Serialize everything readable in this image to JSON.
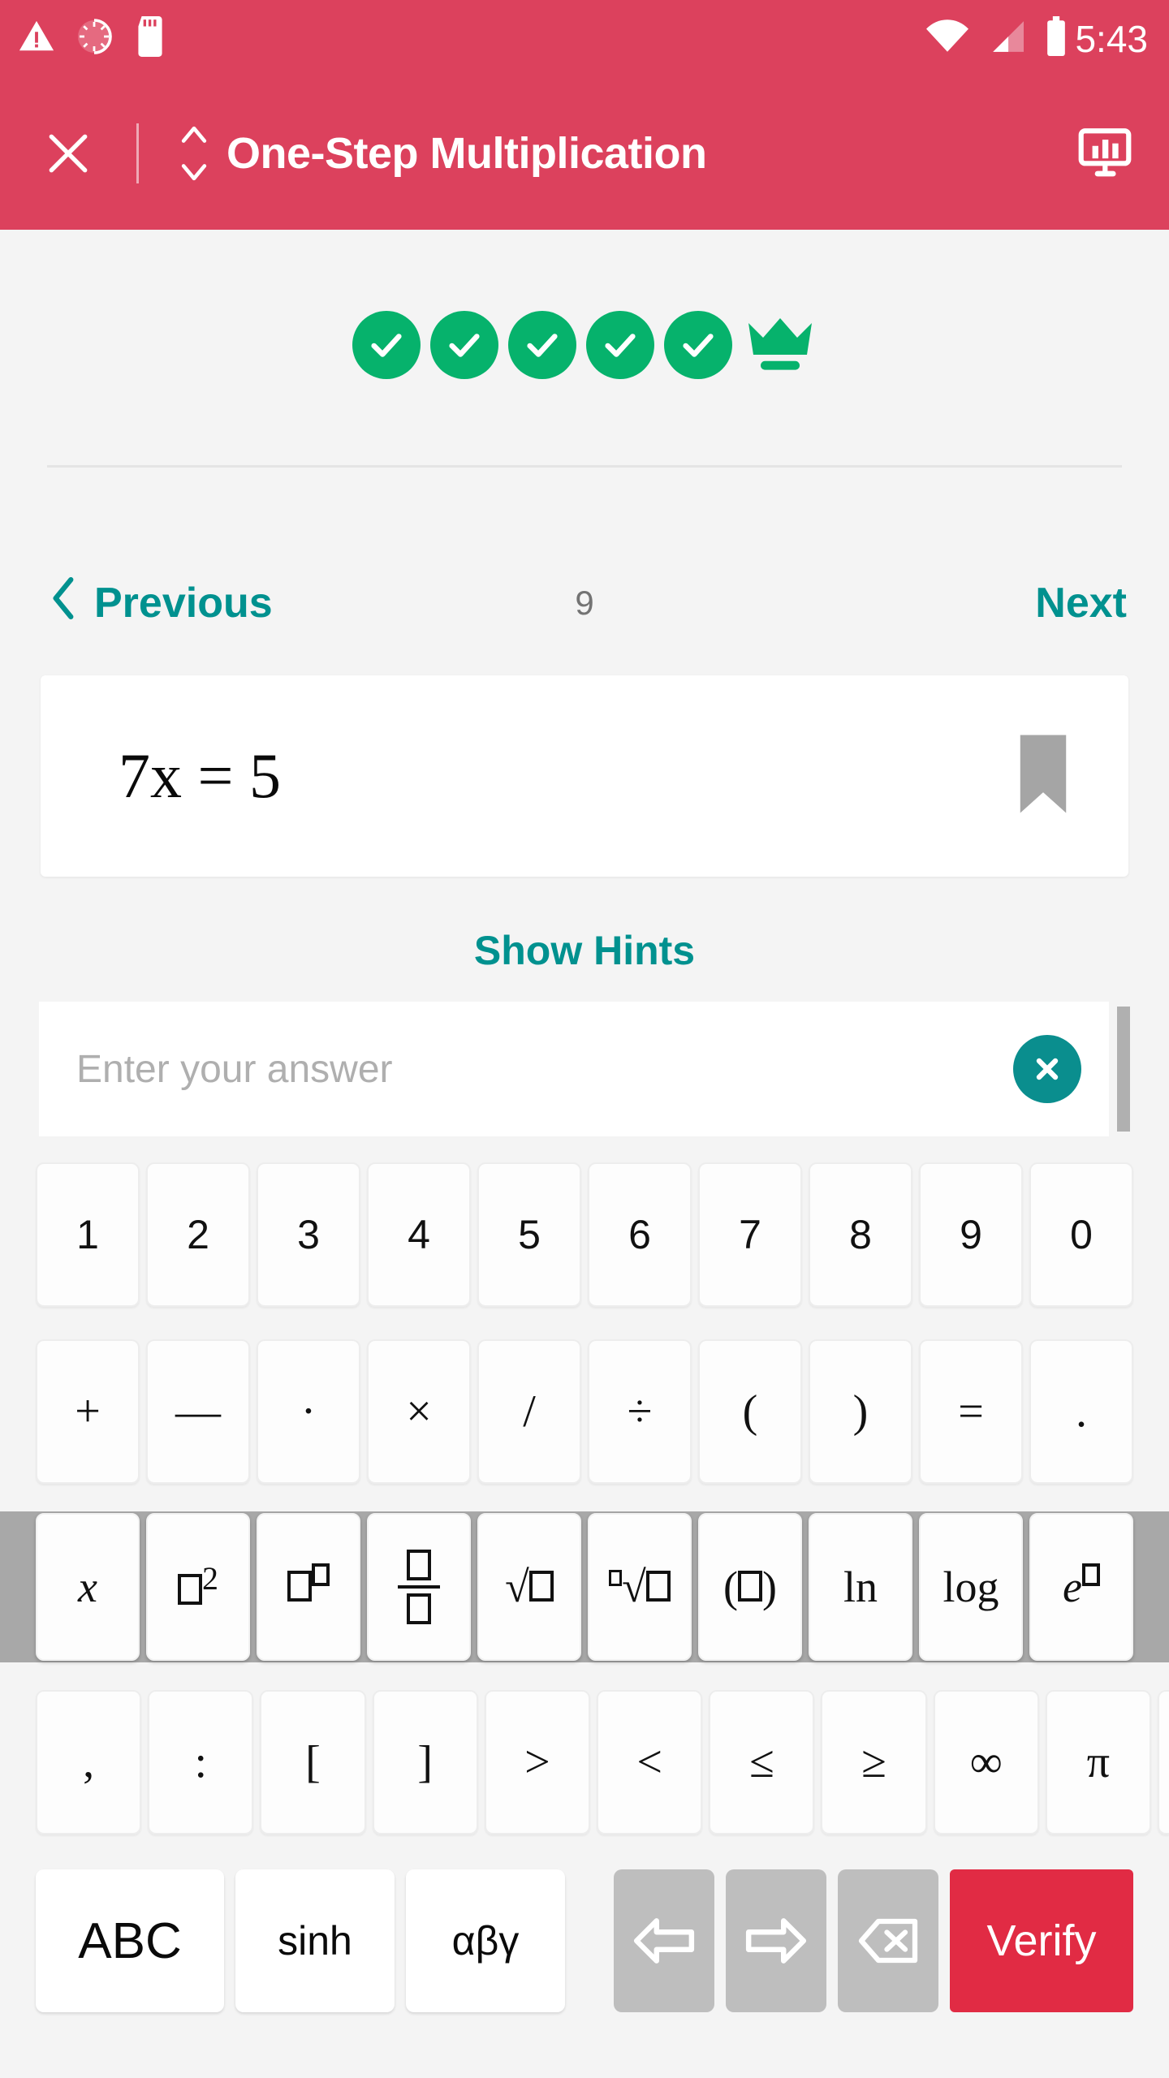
{
  "status_bar": {
    "time": "5:43",
    "left_icons": [
      "warning-triangle-icon",
      "spinner-icon",
      "sd-card-icon"
    ],
    "right_icons": [
      "wifi-icon",
      "cellular-signal-icon",
      "battery-icon"
    ]
  },
  "app_bar": {
    "close_label": "close-icon",
    "sort_label": "sort-updown-icon",
    "title": "One-Step Multiplication",
    "stats_label": "presentation-chart-icon"
  },
  "progress": {
    "completed_count": 5,
    "checks": [
      "check-1",
      "check-2",
      "check-3",
      "check-4",
      "check-5"
    ],
    "crown": "crown-icon",
    "color_done": "#06B26C"
  },
  "nav": {
    "previous_label": "Previous",
    "next_label": "Next",
    "index": "9",
    "link_color": "#00918F"
  },
  "problem": {
    "equation_lhs": "7x",
    "equation_rel": "=",
    "equation_rhs": "5",
    "equation_plain": "7x = 5",
    "bookmark": "bookmark-icon"
  },
  "hints": {
    "label": "Show Hints"
  },
  "answer": {
    "value": "",
    "placeholder": "Enter your answer",
    "clear_label": "clear-icon"
  },
  "keyboard": {
    "row_digits": [
      "1",
      "2",
      "3",
      "4",
      "5",
      "6",
      "7",
      "8",
      "9",
      "0"
    ],
    "row_operators": [
      "+",
      "—",
      "·",
      "×",
      "/",
      "÷",
      "(",
      ")",
      "=",
      "."
    ],
    "row_functions": [
      "x",
      "□²",
      "□^□",
      "□/□",
      "√□",
      "ⁿ√□",
      "(□)",
      "ln",
      "log",
      "e^□"
    ],
    "row_functions_highlighted": true,
    "row_symbols": [
      ",",
      ":",
      "[",
      "]",
      ">",
      "<",
      "≤",
      "≥",
      "∞",
      "π"
    ],
    "row_symbols_has_overflow": true,
    "bottom": {
      "abc": "ABC",
      "sinh": "sinh",
      "greek": "αβγ",
      "arrow_left": "arrow-left-icon",
      "arrow_right": "arrow-right-icon",
      "backspace": "backspace-icon",
      "verify": "Verify"
    }
  },
  "theme": {
    "primary_red": "#DC415D",
    "verify_red": "#E12B44",
    "teal": "#00918F",
    "green": "#06B26C",
    "page_bg": "#F4F4F4",
    "key_gray": "#BEBEBE",
    "highlight_gray": "#A8A8A8"
  }
}
